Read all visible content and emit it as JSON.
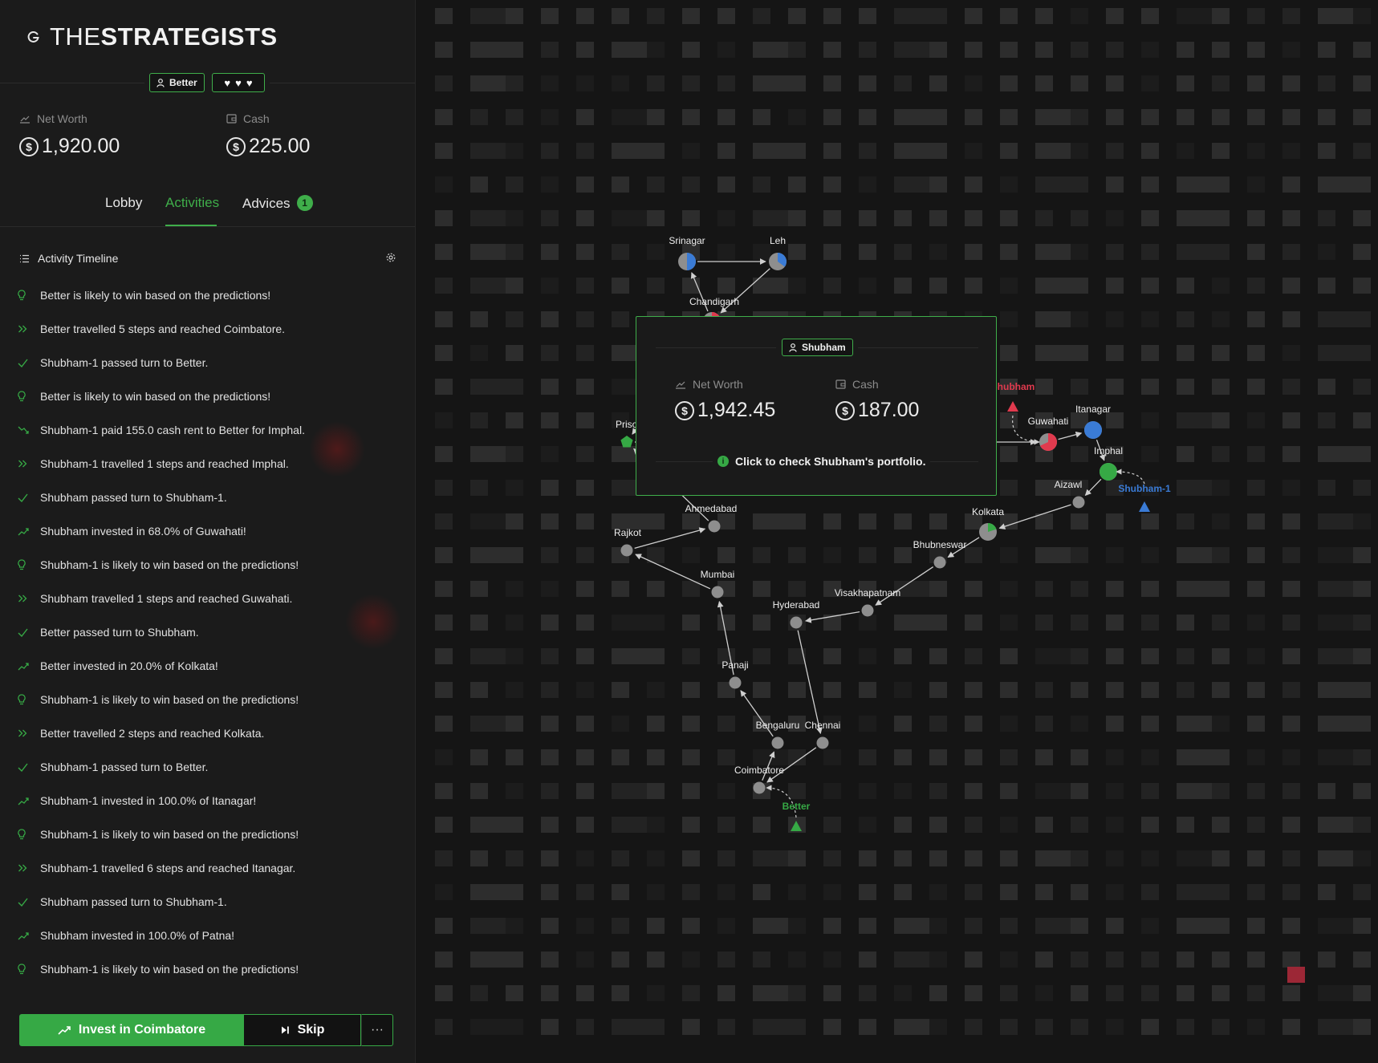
{
  "brand": {
    "light": "THE",
    "bold": "STRATEGISTS"
  },
  "player": {
    "name": "Better",
    "lives": 3,
    "net_worth_label": "Net Worth",
    "net_worth": "1,920.00",
    "cash_label": "Cash",
    "cash": "225.00"
  },
  "tabs": [
    {
      "label": "Lobby",
      "active": false
    },
    {
      "label": "Activities",
      "active": true
    },
    {
      "label": "Advices",
      "active": false,
      "count": "1"
    }
  ],
  "timeline": {
    "title": "Activity Timeline",
    "items": [
      {
        "icon": "bulb-icon",
        "text": "Better is likely to win based on the predictions!"
      },
      {
        "icon": "double-chevron-icon",
        "text": "Better travelled 5 steps and reached Coimbatore."
      },
      {
        "icon": "check-icon",
        "text": "Shubham-1 passed turn to Better."
      },
      {
        "icon": "bulb-icon",
        "text": "Better is likely to win based on the predictions!"
      },
      {
        "icon": "trend-down-icon",
        "text": "Shubham-1 paid 155.0 cash rent to Better for Imphal."
      },
      {
        "icon": "double-chevron-icon",
        "text": "Shubham-1 travelled 1 steps and reached Imphal."
      },
      {
        "icon": "check-icon",
        "text": "Shubham passed turn to Shubham-1."
      },
      {
        "icon": "trend-up-icon",
        "text": "Shubham invested in 68.0% of Guwahati!"
      },
      {
        "icon": "bulb-icon",
        "text": "Shubham-1 is likely to win based on the predictions!"
      },
      {
        "icon": "double-chevron-icon",
        "text": "Shubham travelled 1 steps and reached Guwahati."
      },
      {
        "icon": "check-icon",
        "text": "Better passed turn to Shubham."
      },
      {
        "icon": "trend-up-icon",
        "text": "Better invested in 20.0% of Kolkata!"
      },
      {
        "icon": "bulb-icon",
        "text": "Shubham-1 is likely to win based on the predictions!"
      },
      {
        "icon": "double-chevron-icon",
        "text": "Better travelled 2 steps and reached Kolkata."
      },
      {
        "icon": "check-icon",
        "text": "Shubham-1 passed turn to Better."
      },
      {
        "icon": "trend-up-icon",
        "text": "Shubham-1 invested in 100.0% of Itanagar!"
      },
      {
        "icon": "bulb-icon",
        "text": "Shubham-1 is likely to win based on the predictions!"
      },
      {
        "icon": "double-chevron-icon",
        "text": "Shubham-1 travelled 6 steps and reached Itanagar."
      },
      {
        "icon": "check-icon",
        "text": "Shubham passed turn to Shubham-1."
      },
      {
        "icon": "trend-up-icon",
        "text": "Shubham invested in 100.0% of Patna!"
      },
      {
        "icon": "bulb-icon",
        "text": "Shubham-1 is likely to win based on the predictions!"
      }
    ]
  },
  "actions": {
    "invest": "Invest in Coimbatore",
    "skip": "Skip",
    "more": "···"
  },
  "map": {
    "cities": [
      {
        "name": "Srinagar",
        "owner_color": "#3a7bd5",
        "owned_fraction": 0.5
      },
      {
        "name": "Leh",
        "owner_color": "#3a7bd5",
        "owned_fraction": 0.35
      },
      {
        "name": "Chandigarh",
        "owner_color": "#e03a4e",
        "owned_fraction": 0.5
      },
      {
        "name": "Prison",
        "owner_color": "#36a945",
        "owned_fraction": 1
      },
      {
        "name": "Ahmedabad"
      },
      {
        "name": "Rajkot"
      },
      {
        "name": "Mumbai"
      },
      {
        "name": "Panaji"
      },
      {
        "name": "Bengaluru"
      },
      {
        "name": "Chennai"
      },
      {
        "name": "Coimbatore"
      },
      {
        "name": "Hyderabad"
      },
      {
        "name": "Visakhapatnam"
      },
      {
        "name": "Bhubneswar"
      },
      {
        "name": "Kolkata",
        "owner_color": "#36a945",
        "owned_fraction": 0.2
      },
      {
        "name": "Aizawl"
      },
      {
        "name": "Imphal",
        "owner_color": "#36a945",
        "owned_fraction": 1
      },
      {
        "name": "Itanagar",
        "owner_color": "#3a7bd5",
        "owned_fraction": 1
      },
      {
        "name": "Guwahati",
        "owner_color": "#e03a4e",
        "owned_fraction": 0.68
      }
    ],
    "players": [
      {
        "name": "Better",
        "color": "#36a945"
      },
      {
        "name": "Shubham",
        "color": "#e03a4e"
      },
      {
        "name": "Shubham-1",
        "color": "#3a7bd5"
      }
    ]
  },
  "popup": {
    "name": "Shubham",
    "net_worth_label": "Net Worth",
    "net_worth": "1,942.45",
    "cash_label": "Cash",
    "cash": "187.00",
    "hint": "Click to check Shubham's portfolio."
  },
  "colors": {
    "accent": "#36a945",
    "danger": "#e03a4e",
    "info": "#3a7bd5"
  }
}
